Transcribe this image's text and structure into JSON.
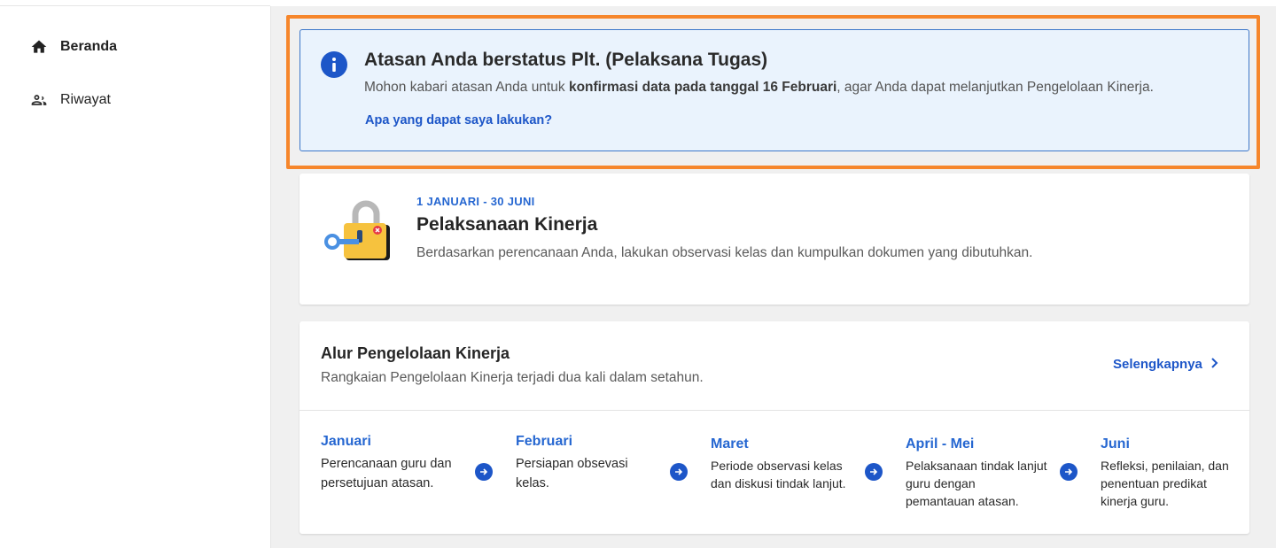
{
  "sidebar": {
    "items": [
      {
        "label": "Beranda",
        "icon": "home-icon",
        "active": true
      },
      {
        "label": "Riwayat",
        "icon": "people-icon",
        "active": false
      }
    ]
  },
  "alert": {
    "title": "Atasan Anda berstatus Plt. (Pelaksana Tugas)",
    "desc_prefix": "Mohon kabari atasan Anda untuk ",
    "desc_bold": "konfirmasi data pada tanggal 16 Februari",
    "desc_suffix": ", agar Anda dapat melanjutkan Pengelolaan Kinerja.",
    "link": "Apa yang dapat saya lakukan?",
    "icon": "info-icon"
  },
  "phase_card": {
    "period": "1 JANUARI - 30 JUNI",
    "title": "Pelaksanaan Kinerja",
    "description": "Berdasarkan perencanaan Anda, lakukan observasi kelas dan kumpulkan dokumen yang dibutuhkan.",
    "icon": "locked-padlock-icon"
  },
  "flow_card": {
    "title": "Alur Pengelolaan Kinerja",
    "subtitle": "Rangkaian Pengelolaan Kinerja terjadi dua kali dalam setahun.",
    "more_label": "Selengkapnya",
    "steps": [
      {
        "month": "Januari",
        "text": "Perencanaan guru dan persetujuan atasan."
      },
      {
        "month": "Februari",
        "text": "Persiapan obsevasi kelas."
      },
      {
        "month": "Maret",
        "text": "Periode observasi kelas dan diskusi tindak lanjut."
      },
      {
        "month": "April - Mei",
        "text": "Pelaksanaan tindak lanjut guru dengan pemantauan atasan."
      },
      {
        "month": "Juni",
        "text": "Refleksi, penilaian, dan penentuan predikat kinerja guru."
      }
    ]
  },
  "colors": {
    "accent": "#1d56c8",
    "highlight_border": "#f6862b",
    "alert_bg": "#eaf3fd"
  }
}
